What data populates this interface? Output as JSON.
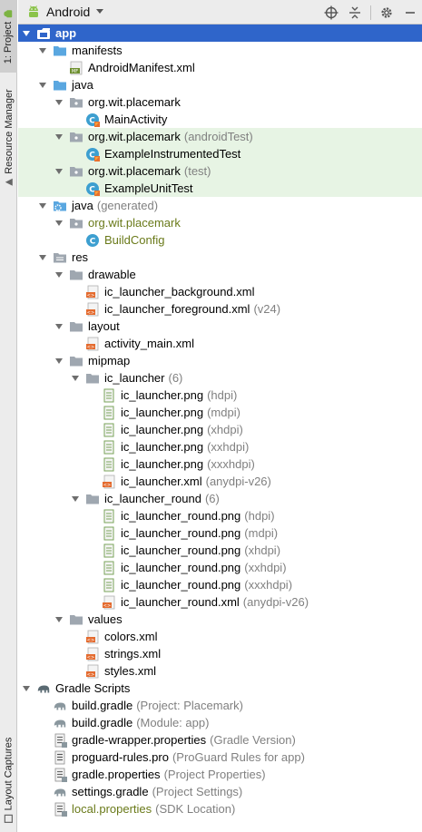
{
  "side_tabs": {
    "project": "1: Project",
    "resource_manager": "Resource Manager",
    "layout_captures": "Layout Captures"
  },
  "toolbar": {
    "view_mode": "Android"
  },
  "tree": [
    {
      "id": "app",
      "label": "app",
      "hint": "",
      "level": 0,
      "arrow": "down",
      "icon": "module",
      "state": "selected"
    },
    {
      "id": "manifests",
      "label": "manifests",
      "hint": "",
      "level": 1,
      "arrow": "down",
      "icon": "folder-blue"
    },
    {
      "id": "android-manifest",
      "label": "AndroidManifest.xml",
      "hint": "",
      "level": 2,
      "arrow": "none",
      "icon": "manifest"
    },
    {
      "id": "java",
      "label": "java",
      "hint": "",
      "level": 1,
      "arrow": "down",
      "icon": "folder-blue"
    },
    {
      "id": "pkg-main",
      "label": "org.wit.placemark",
      "hint": "",
      "level": 2,
      "arrow": "down",
      "icon": "package"
    },
    {
      "id": "main-activity",
      "label": "MainActivity",
      "hint": "",
      "level": 3,
      "arrow": "none",
      "icon": "kotlin-class"
    },
    {
      "id": "pkg-androidtest",
      "label": "org.wit.placemark",
      "hint": "(androidTest)",
      "level": 2,
      "arrow": "down",
      "icon": "package",
      "state": "test"
    },
    {
      "id": "instrumented-test",
      "label": "ExampleInstrumentedTest",
      "hint": "",
      "level": 3,
      "arrow": "none",
      "icon": "kotlin-class",
      "state": "test"
    },
    {
      "id": "pkg-test",
      "label": "org.wit.placemark",
      "hint": "(test)",
      "level": 2,
      "arrow": "down",
      "icon": "package",
      "state": "test"
    },
    {
      "id": "unit-test",
      "label": "ExampleUnitTest",
      "hint": "",
      "level": 3,
      "arrow": "none",
      "icon": "kotlin-class",
      "state": "test"
    },
    {
      "id": "java-generated",
      "label": "java",
      "hint": "(generated)",
      "level": 1,
      "arrow": "down",
      "icon": "folder-gen"
    },
    {
      "id": "pkg-generated",
      "label": "org.wit.placemark",
      "hint": "",
      "level": 2,
      "arrow": "down",
      "icon": "package",
      "style": "olive"
    },
    {
      "id": "build-config",
      "label": "BuildConfig",
      "hint": "",
      "level": 3,
      "arrow": "none",
      "icon": "java-class",
      "style": "olive"
    },
    {
      "id": "res",
      "label": "res",
      "hint": "",
      "level": 1,
      "arrow": "down",
      "icon": "folder-res"
    },
    {
      "id": "drawable",
      "label": "drawable",
      "hint": "",
      "level": 2,
      "arrow": "down",
      "icon": "folder-grey"
    },
    {
      "id": "ic-bg",
      "label": "ic_launcher_background.xml",
      "hint": "",
      "level": 3,
      "arrow": "none",
      "icon": "xml"
    },
    {
      "id": "ic-fg",
      "label": "ic_launcher_foreground.xml",
      "hint": "(v24)",
      "level": 3,
      "arrow": "none",
      "icon": "xml"
    },
    {
      "id": "layout",
      "label": "layout",
      "hint": "",
      "level": 2,
      "arrow": "down",
      "icon": "folder-grey"
    },
    {
      "id": "activity-main",
      "label": "activity_main.xml",
      "hint": "",
      "level": 3,
      "arrow": "none",
      "icon": "xml"
    },
    {
      "id": "mipmap",
      "label": "mipmap",
      "hint": "",
      "level": 2,
      "arrow": "down",
      "icon": "folder-grey"
    },
    {
      "id": "ic-launcher-group",
      "label": "ic_launcher",
      "hint": "(6)",
      "level": 3,
      "arrow": "down",
      "icon": "folder-grey"
    },
    {
      "id": "ic-l-hdpi",
      "label": "ic_launcher.png",
      "hint": "(hdpi)",
      "level": 4,
      "arrow": "none",
      "icon": "png"
    },
    {
      "id": "ic-l-mdpi",
      "label": "ic_launcher.png",
      "hint": "(mdpi)",
      "level": 4,
      "arrow": "none",
      "icon": "png"
    },
    {
      "id": "ic-l-xhdpi",
      "label": "ic_launcher.png",
      "hint": "(xhdpi)",
      "level": 4,
      "arrow": "none",
      "icon": "png"
    },
    {
      "id": "ic-l-xxhdpi",
      "label": "ic_launcher.png",
      "hint": "(xxhdpi)",
      "level": 4,
      "arrow": "none",
      "icon": "png"
    },
    {
      "id": "ic-l-xxxhdpi",
      "label": "ic_launcher.png",
      "hint": "(xxxhdpi)",
      "level": 4,
      "arrow": "none",
      "icon": "png"
    },
    {
      "id": "ic-l-xml",
      "label": "ic_launcher.xml",
      "hint": "(anydpi-v26)",
      "level": 4,
      "arrow": "none",
      "icon": "xml"
    },
    {
      "id": "ic-round-group",
      "label": "ic_launcher_round",
      "hint": "(6)",
      "level": 3,
      "arrow": "down",
      "icon": "folder-grey"
    },
    {
      "id": "ic-r-hdpi",
      "label": "ic_launcher_round.png",
      "hint": "(hdpi)",
      "level": 4,
      "arrow": "none",
      "icon": "png"
    },
    {
      "id": "ic-r-mdpi",
      "label": "ic_launcher_round.png",
      "hint": "(mdpi)",
      "level": 4,
      "arrow": "none",
      "icon": "png"
    },
    {
      "id": "ic-r-xhdpi",
      "label": "ic_launcher_round.png",
      "hint": "(xhdpi)",
      "level": 4,
      "arrow": "none",
      "icon": "png"
    },
    {
      "id": "ic-r-xxhdpi",
      "label": "ic_launcher_round.png",
      "hint": "(xxhdpi)",
      "level": 4,
      "arrow": "none",
      "icon": "png"
    },
    {
      "id": "ic-r-xxxhdpi",
      "label": "ic_launcher_round.png",
      "hint": "(xxxhdpi)",
      "level": 4,
      "arrow": "none",
      "icon": "png"
    },
    {
      "id": "ic-r-xml",
      "label": "ic_launcher_round.xml",
      "hint": "(anydpi-v26)",
      "level": 4,
      "arrow": "none",
      "icon": "xml"
    },
    {
      "id": "values",
      "label": "values",
      "hint": "",
      "level": 2,
      "arrow": "down",
      "icon": "folder-grey"
    },
    {
      "id": "colors",
      "label": "colors.xml",
      "hint": "",
      "level": 3,
      "arrow": "none",
      "icon": "xml"
    },
    {
      "id": "strings",
      "label": "strings.xml",
      "hint": "",
      "level": 3,
      "arrow": "none",
      "icon": "xml"
    },
    {
      "id": "styles",
      "label": "styles.xml",
      "hint": "",
      "level": 3,
      "arrow": "none",
      "icon": "xml"
    },
    {
      "id": "gradle-scripts",
      "label": "Gradle Scripts",
      "hint": "",
      "level": 0,
      "arrow": "down",
      "icon": "gradle-elephant"
    },
    {
      "id": "build-gradle-project",
      "label": "build.gradle",
      "hint": "(Project: Placemark)",
      "level": 1,
      "arrow": "none",
      "icon": "gradle"
    },
    {
      "id": "build-gradle-module",
      "label": "build.gradle",
      "hint": "(Module: app)",
      "level": 1,
      "arrow": "none",
      "icon": "gradle"
    },
    {
      "id": "gradle-wrapper",
      "label": "gradle-wrapper.properties",
      "hint": "(Gradle Version)",
      "level": 1,
      "arrow": "none",
      "icon": "properties"
    },
    {
      "id": "proguard",
      "label": "proguard-rules.pro",
      "hint": "(ProGuard Rules for app)",
      "level": 1,
      "arrow": "none",
      "icon": "text"
    },
    {
      "id": "gradle-properties",
      "label": "gradle.properties",
      "hint": "(Project Properties)",
      "level": 1,
      "arrow": "none",
      "icon": "properties"
    },
    {
      "id": "settings-gradle",
      "label": "settings.gradle",
      "hint": "(Project Settings)",
      "level": 1,
      "arrow": "none",
      "icon": "gradle"
    },
    {
      "id": "local-properties",
      "label": "local.properties",
      "hint": "(SDK Location)",
      "level": 1,
      "arrow": "none",
      "icon": "properties",
      "style": "olive"
    }
  ],
  "colors": {
    "selection": "#2f65ca",
    "test_highlight": "#e7f4e4",
    "hint": "#808080"
  }
}
